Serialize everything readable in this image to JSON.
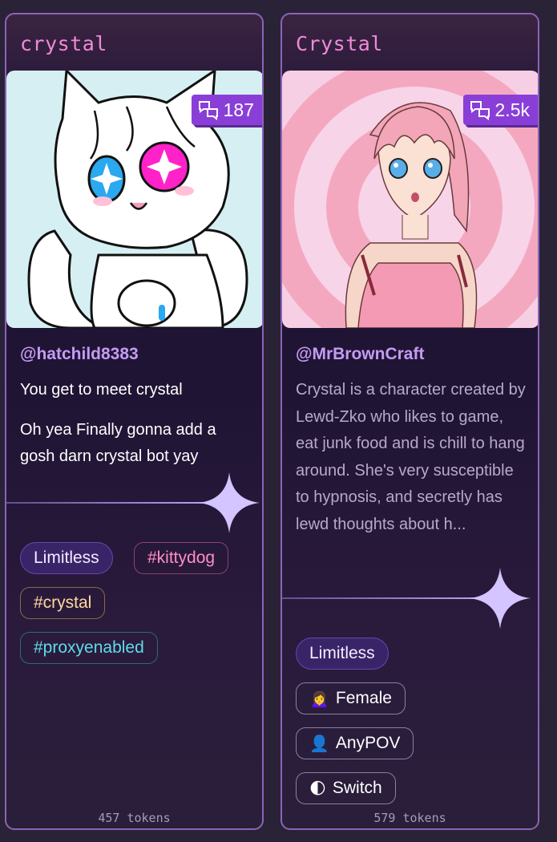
{
  "cards": [
    {
      "title": "crystal",
      "message_count": "187",
      "author": "@hatchild8383",
      "description": [
        "You get to meet crystal",
        "Oh yea Finally gonna add a gosh darn crystal bot yay"
      ],
      "tags": [
        {
          "label": "Limitless",
          "emoji": ""
        },
        {
          "label": "#kittydog",
          "emoji": ""
        },
        {
          "label": "#crystal",
          "emoji": ""
        },
        {
          "label": "#proxyenabled",
          "emoji": ""
        }
      ],
      "tokens": "457 tokens",
      "image_icon": "white-cat-girl-character-art"
    },
    {
      "title": "Crystal",
      "message_count": "2.5k",
      "author": "@MrBrownCraft",
      "description": [
        "Crystal is a character created by Lewd-Zko who likes to game, eat junk food and is chill to hang around. She's very susceptible to hypnosis, and secretly has lewd thoughts about h..."
      ],
      "tags": [
        {
          "label": "Limitless",
          "emoji": ""
        },
        {
          "label": "Female",
          "emoji": "🙍‍♀️"
        },
        {
          "label": "AnyPOV",
          "emoji": "👤"
        },
        {
          "label": "Switch",
          "emoji": "🌓"
        }
      ],
      "tokens": "579 tokens",
      "image_icon": "pink-haired-girl-spiral-art"
    }
  ],
  "colors": {
    "title": "#f08ad8",
    "author": "#c49cf2",
    "badge": "#8a3ed8",
    "card_border": "#8a64b8"
  },
  "icons": {
    "message": "chat-bubbles-icon",
    "sparkle": "sparkle-icon"
  }
}
